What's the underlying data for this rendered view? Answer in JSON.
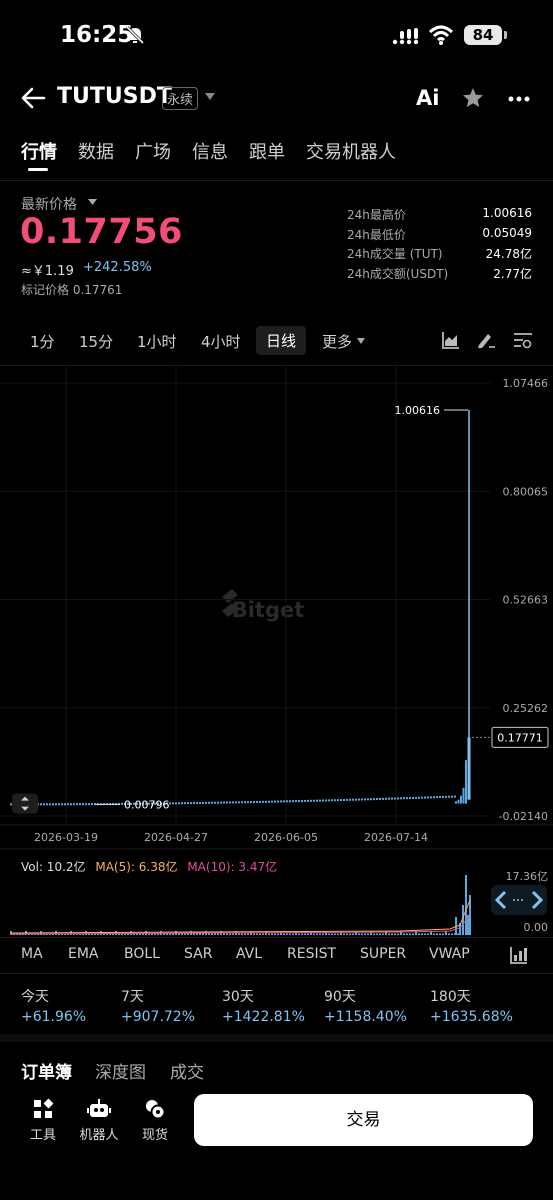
{
  "status": {
    "time": "16:25",
    "battery": "84"
  },
  "header": {
    "symbol": "TUTUSDT",
    "badge": "永续",
    "ai_label": "Ai"
  },
  "tabs": [
    "行情",
    "数据",
    "广场",
    "信息",
    "跟单",
    "交易机器人"
  ],
  "price_panel": {
    "label": "最新价格",
    "last_price": "0.17756",
    "cny": "≈￥1.19",
    "change": "+242.58%",
    "mark_price": "标记价格 0.17761",
    "stats": [
      {
        "label": "24h最高价",
        "value": "1.00616"
      },
      {
        "label": "24h最低价",
        "value": "0.05049"
      },
      {
        "label": "24h成交量 (TUT)",
        "value": "24.78亿"
      },
      {
        "label": "24h成交额(USDT)",
        "value": "2.77亿"
      }
    ]
  },
  "intervals": [
    "1分",
    "15分",
    "1小时",
    "4小时",
    "日线",
    "更多"
  ],
  "active_interval": "日线",
  "chart_data": {
    "type": "line",
    "title": "",
    "y_ticks": [
      "1.07466",
      "0.80065",
      "0.52663",
      "0.25262",
      "-0.02140"
    ],
    "x_ticks": [
      "2026-03-19",
      "2026-04-27",
      "2026-06-05",
      "2026-07-14"
    ],
    "ylim": [
      -0.0214,
      1.07466
    ],
    "high_label": "1.00616",
    "low_label": "0.00796",
    "current_price_tag": "0.17771",
    "watermark": "Bitget",
    "series": [
      {
        "values": [
          0.00796,
          0.0085,
          0.009,
          0.0095,
          0.0098,
          0.0102,
          0.0105,
          0.0108,
          0.011,
          0.0115,
          0.012,
          0.0125,
          0.013,
          0.014,
          0.016,
          0.02,
          0.03,
          0.05,
          0.12,
          1.00616,
          0.17771
        ]
      }
    ],
    "volume": {
      "label": "Vol: 10.2亿",
      "ma5": "MA(5): 6.38亿",
      "ma10": "MA(10): 3.47亿",
      "max_tick": "17.36亿",
      "min_tick": "0.00"
    }
  },
  "indicators": [
    "MA",
    "EMA",
    "BOLL",
    "SAR",
    "AVL",
    "RESIST",
    "SUPER",
    "VWAP"
  ],
  "performance": [
    {
      "label": "今天",
      "value": "+61.96%"
    },
    {
      "label": "7天",
      "value": "+907.72%"
    },
    {
      "label": "30天",
      "value": "+1422.81%"
    },
    {
      "label": "90天",
      "value": "+1158.40%"
    },
    {
      "label": "180天",
      "value": "+1635.68%"
    }
  ],
  "bottom_tabs": [
    "订单簿",
    "深度图",
    "成交"
  ],
  "bottom_nav": [
    {
      "label": "工具",
      "icon": "tools-icon"
    },
    {
      "label": "机器人",
      "icon": "robot-icon"
    },
    {
      "label": "现货",
      "icon": "spot-icon"
    }
  ],
  "trade_button": "交易",
  "colors": {
    "up": "#7ec4f2",
    "price": "#f24e77",
    "ma5": "#f5b35a",
    "ma10": "#e04d9a"
  }
}
